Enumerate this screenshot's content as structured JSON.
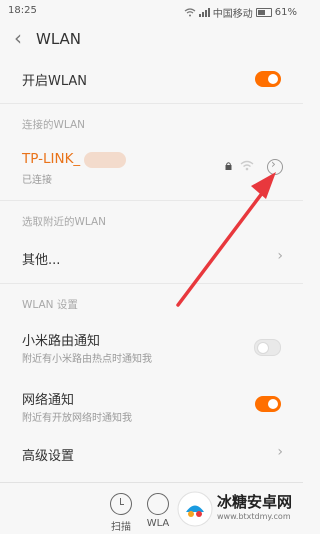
{
  "status_bar": {
    "time": "18:25",
    "carrier": "中国移动",
    "battery": "61%"
  },
  "header": {
    "title": "WLAN"
  },
  "wlan_toggle": {
    "label": "开启WLAN",
    "on": true
  },
  "connected_section": {
    "title": "连接的WLAN"
  },
  "connected_network": {
    "name": "TP-LINK_",
    "status": "已连接"
  },
  "nearby_section": {
    "title": "选取附近的WLAN"
  },
  "other": {
    "label": "其他..."
  },
  "settings_section": {
    "title": "WLAN 设置"
  },
  "router_notify": {
    "label": "小米路由通知",
    "sub": "附近有小米路由热点时通知我",
    "on": false
  },
  "network_notify": {
    "label": "网络通知",
    "sub": "附近有开放网络时通知我",
    "on": true
  },
  "advanced": {
    "label": "高级设置"
  },
  "bottom_bar": {
    "scan_label": "扫描",
    "wlan_label": "WLA"
  },
  "watermark": {
    "title": "冰糖安卓网",
    "url": "www.btxtdmy.com"
  },
  "colors": {
    "accent": "#ff6f00",
    "connected_name": "#e9731a",
    "arrow": "#e8383d"
  }
}
